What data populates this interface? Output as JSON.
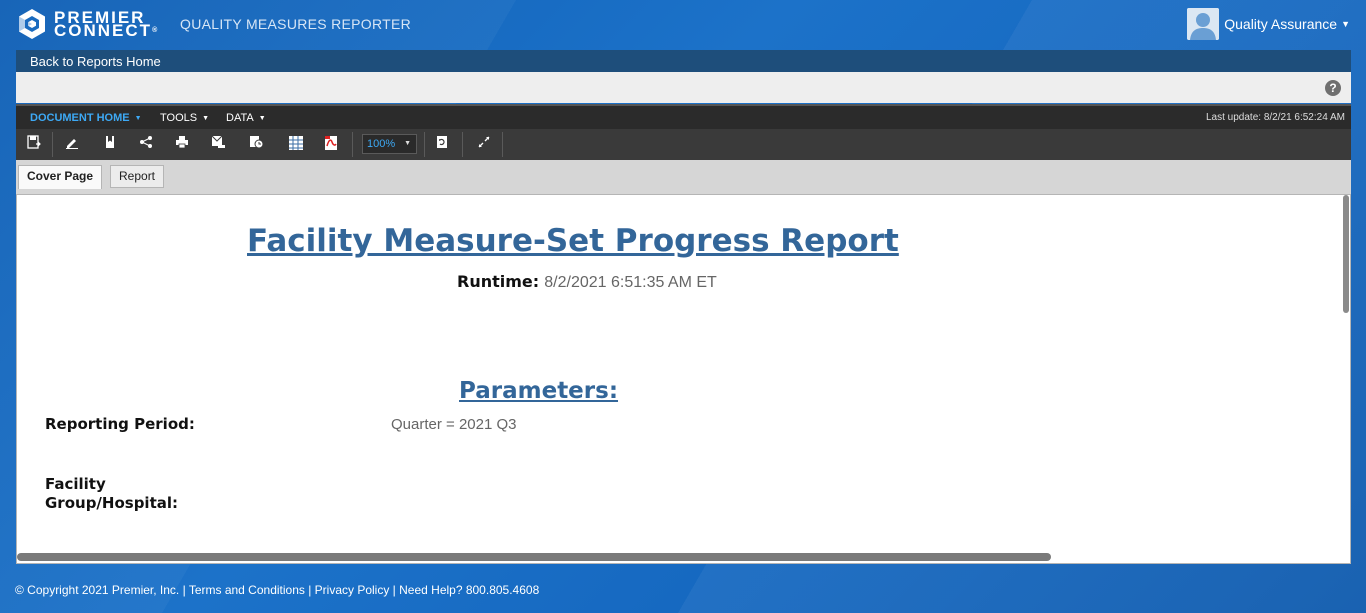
{
  "header": {
    "logo_line1": "PREMIER",
    "logo_line2": "CONNECT",
    "logo_reg": "®",
    "app_title": "QUALITY MEASURES REPORTER",
    "user_name": "Quality Assurance"
  },
  "nav": {
    "back_label": "Back to Reports Home"
  },
  "viewer": {
    "menu": [
      {
        "label": "DOCUMENT HOME",
        "active": true
      },
      {
        "label": "TOOLS",
        "active": false
      },
      {
        "label": "DATA",
        "active": false
      }
    ],
    "last_update": "Last update: 8/2/21 6:52:24 AM",
    "zoom": "100%",
    "toolbar_icons": [
      "save-icon",
      "edit-icon",
      "bookmark-icon",
      "share-icon",
      "print-icon",
      "email-icon",
      "schedule-icon",
      "export-excel-icon",
      "export-pdf-icon",
      "zoom-select",
      "refresh-icon",
      "fullscreen-icon"
    ]
  },
  "tabs": [
    {
      "label": "Cover Page",
      "active": true
    },
    {
      "label": "Report",
      "active": false
    }
  ],
  "report": {
    "title": "Facility Measure-Set Progress Report",
    "runtime_label": "Runtime:",
    "runtime_value": "8/2/2021 6:51:35 AM ET",
    "params_title": "Parameters:",
    "reporting_period_label": "Reporting Period:",
    "reporting_period_value": "Quarter = 2021 Q3",
    "facility_label_line1": "Facility",
    "facility_label_line2": "Group/Hospital:"
  },
  "footer": {
    "text": "© Copyright 2021 Premier, Inc. | Terms and Conditions | Privacy Policy | Need Help? 800.805.4608"
  },
  "colors": {
    "brand_blue": "#1a6bbf",
    "report_heading": "#336699",
    "active_menu": "#3da9f5"
  }
}
